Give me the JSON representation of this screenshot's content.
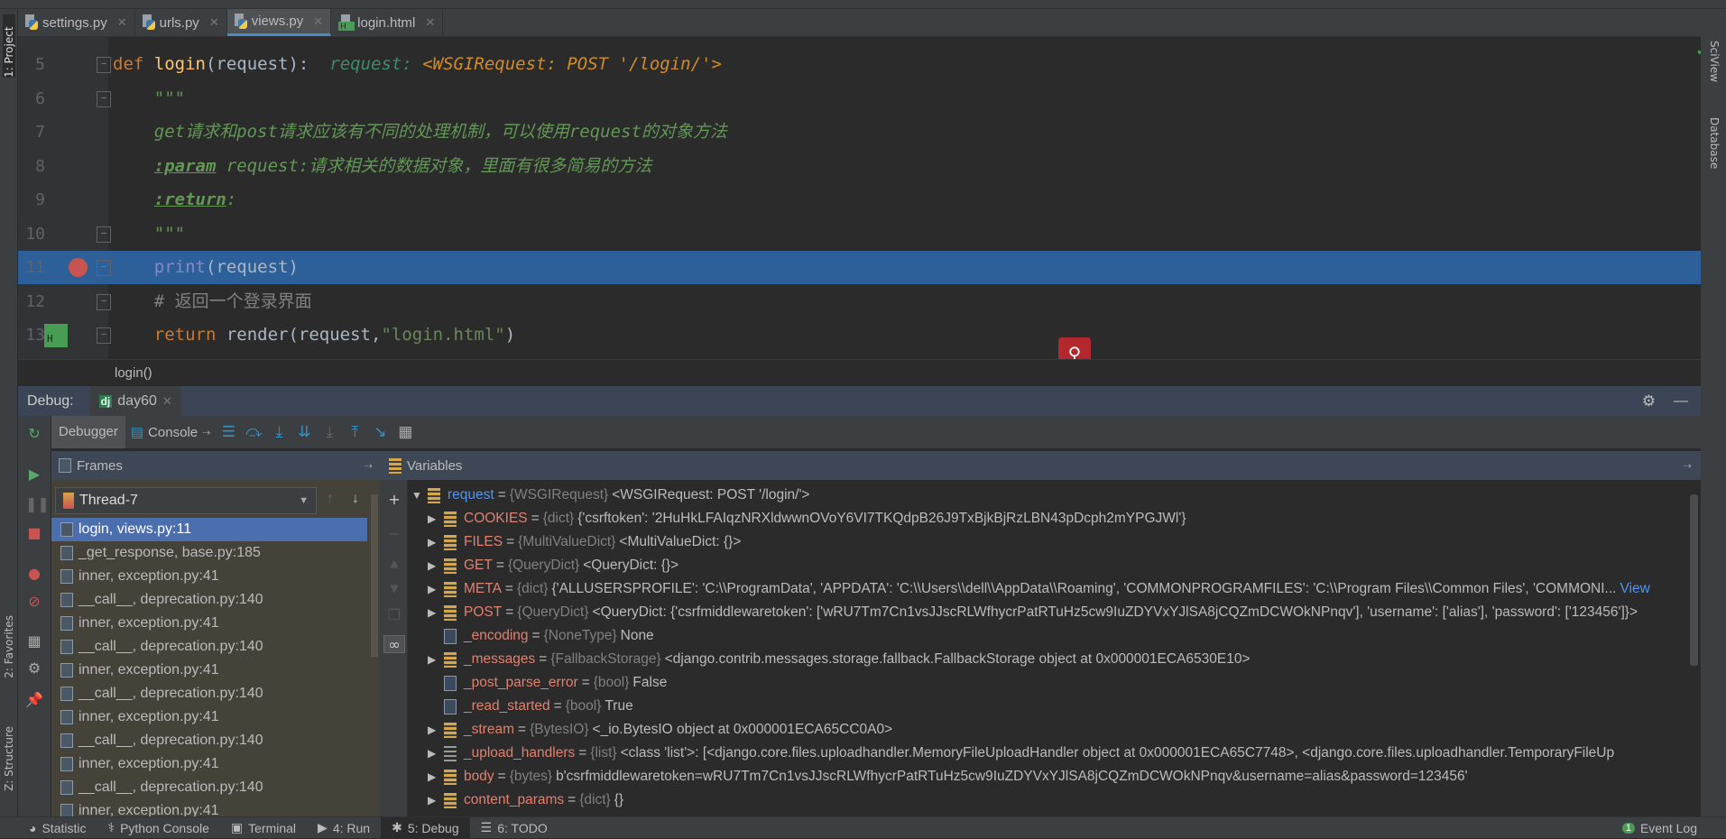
{
  "side_tools": {
    "project": "1: Project",
    "favorites": "2: Favorites",
    "structure": "Z: Structure",
    "sciview": "SciView",
    "database": "Database"
  },
  "tabs": [
    {
      "label": "settings.py",
      "icon": "python-file-icon",
      "active": false
    },
    {
      "label": "urls.py",
      "icon": "python-file-icon",
      "active": false
    },
    {
      "label": "views.py",
      "icon": "python-file-icon",
      "active": true
    },
    {
      "label": "login.html",
      "icon": "html-file-icon",
      "active": false
    }
  ],
  "editor": {
    "lines": [
      {
        "num": "5",
        "tokens": [
          [
            "def ",
            "kw"
          ],
          [
            "login",
            "fn"
          ],
          [
            "(request):  ",
            "id"
          ],
          [
            "request: ",
            "hint"
          ],
          [
            "<WSGIRequest: POST '/login/'>",
            "hintv"
          ]
        ]
      },
      {
        "num": "6",
        "tokens": [
          [
            "    \"\"\"",
            "doc"
          ]
        ]
      },
      {
        "num": "7",
        "tokens": [
          [
            "    get请求和post请求应该有不同的处理机制，可以使用request的对象方法",
            "doc"
          ]
        ]
      },
      {
        "num": "8",
        "tokens": [
          [
            "    ",
            "doc"
          ],
          [
            ":param",
            "tag"
          ],
          [
            " request:请求相关的数据对象，里面有很多简易的方法",
            "doc"
          ]
        ]
      },
      {
        "num": "9",
        "tokens": [
          [
            "    ",
            "doc"
          ],
          [
            ":return",
            "tag"
          ],
          [
            ":",
            "doc"
          ]
        ]
      },
      {
        "num": "10",
        "tokens": [
          [
            "    \"\"\"",
            "doc"
          ]
        ]
      },
      {
        "num": "11",
        "tokens": [
          [
            "    ",
            "id"
          ],
          [
            "print",
            "bi"
          ],
          [
            "(request)",
            "id"
          ]
        ],
        "highlighted": true,
        "breakpoint": true
      },
      {
        "num": "12",
        "tokens": [
          [
            "    # 返回一个登录界面",
            "cm"
          ]
        ]
      },
      {
        "num": "13",
        "tokens": [
          [
            "    ",
            "id"
          ],
          [
            "return ",
            "kw"
          ],
          [
            "render(request,",
            "id"
          ],
          [
            "\"login.html\"",
            "str"
          ],
          [
            ")",
            "id"
          ]
        ]
      }
    ],
    "breadcrumb": "login()"
  },
  "debug": {
    "label": "Debug:",
    "session": "day60",
    "tabs": [
      "Debugger",
      "Console"
    ],
    "frames_title": "Frames",
    "variables_title": "Variables",
    "thread": "Thread-7",
    "frames": [
      "login, views.py:11",
      "_get_response, base.py:185",
      "inner, exception.py:41",
      "__call__, deprecation.py:140",
      "inner, exception.py:41",
      "__call__, deprecation.py:140",
      "inner, exception.py:41",
      "__call__, deprecation.py:140",
      "inner, exception.py:41",
      "__call__, deprecation.py:140",
      "inner, exception.py:41",
      "__call__, deprecation.py:140",
      "inner, exception.py:41"
    ],
    "variables": [
      {
        "name": "request",
        "type": "{WSGIRequest}",
        "value": "<WSGIRequest: POST '/login/'>",
        "expanded": true,
        "level": 0,
        "icon": "field"
      },
      {
        "name": "COOKIES",
        "type": "{dict}",
        "value": "{'csrftoken': '2HuHkLFAIqzNRXldwwnOVoY6VI7TKQdpB26J9TxBjkBjRzLBN43pDcph2mYPGJWl'}",
        "level": 1,
        "icon": "field",
        "expandable": true
      },
      {
        "name": "FILES",
        "type": "{MultiValueDict}",
        "value": "<MultiValueDict: {}>",
        "level": 1,
        "icon": "field",
        "expandable": true
      },
      {
        "name": "GET",
        "type": "{QueryDict}",
        "value": "<QueryDict: {}>",
        "level": 1,
        "icon": "field",
        "expandable": true
      },
      {
        "name": "META",
        "type": "{dict}",
        "value": "{'ALLUSERSPROFILE': 'C:\\\\ProgramData', 'APPDATA': 'C:\\\\Users\\\\dell\\\\AppData\\\\Roaming', 'COMMONPROGRAMFILES': 'C:\\\\Program Files\\\\Common Files', 'COMMONI...",
        "link": "View",
        "level": 1,
        "icon": "field",
        "expandable": true
      },
      {
        "name": "POST",
        "type": "{QueryDict}",
        "value": "<QueryDict: {'csrfmiddlewaretoken': ['wRU7Tm7Cn1vsJJscRLWfhycrPatRTuHz5cw9IuZDYVxYJlSA8jCQZmDCWOkNPnqv'], 'username': ['alias'], 'password': ['123456']}>",
        "level": 1,
        "icon": "field",
        "expandable": true
      },
      {
        "name": "_encoding",
        "type": "{NoneType}",
        "value": "None",
        "level": 1,
        "icon": "primitive"
      },
      {
        "name": "_messages",
        "type": "{FallbackStorage}",
        "value": "<django.contrib.messages.storage.fallback.FallbackStorage object at 0x000001ECA6530E10>",
        "level": 1,
        "icon": "field",
        "expandable": true
      },
      {
        "name": "_post_parse_error",
        "type": "{bool}",
        "value": "False",
        "level": 1,
        "icon": "primitive"
      },
      {
        "name": "_read_started",
        "type": "{bool}",
        "value": "True",
        "level": 1,
        "icon": "primitive"
      },
      {
        "name": "_stream",
        "type": "{BytesIO}",
        "value": "<_io.BytesIO object at 0x000001ECA65CC0A0>",
        "level": 1,
        "icon": "field",
        "expandable": true
      },
      {
        "name": "_upload_handlers",
        "type": "{list}",
        "value": "<class 'list'>: [<django.core.files.uploadhandler.MemoryFileUploadHandler object at 0x000001ECA65C7748>, <django.core.files.uploadhandler.TemporaryFileUp",
        "level": 1,
        "icon": "list",
        "expandable": true
      },
      {
        "name": "body",
        "type": "{bytes}",
        "value": "b'csrfmiddlewaretoken=wRU7Tm7Cn1vsJJscRLWfhycrPatRTuHz5cw9IuZDYVxYJlSA8jCQZmDCWOkNPnqv&username=alias&password=123456'",
        "level": 1,
        "icon": "field",
        "expandable": true
      },
      {
        "name": "content_params",
        "type": "{dict}",
        "value": "{}",
        "level": 1,
        "icon": "field",
        "expandable": true
      }
    ]
  },
  "bottom": {
    "items": [
      {
        "label": "Statistic",
        "icon": "statistic-icon"
      },
      {
        "label": "Python Console",
        "icon": "python-icon"
      },
      {
        "label": "Terminal",
        "icon": "terminal-icon"
      },
      {
        "label": "4: Run",
        "icon": "run-icon"
      },
      {
        "label": "5: Debug",
        "icon": "bug-icon",
        "active": true
      },
      {
        "label": "6: TODO",
        "icon": "todo-icon"
      }
    ],
    "event_log": "Event Log",
    "event_count": "1"
  },
  "colors": {
    "selection": "#2d5f99",
    "frame_selected": "#4b6eaf",
    "breakpoint": "#c75450",
    "header": "#3d4756"
  }
}
